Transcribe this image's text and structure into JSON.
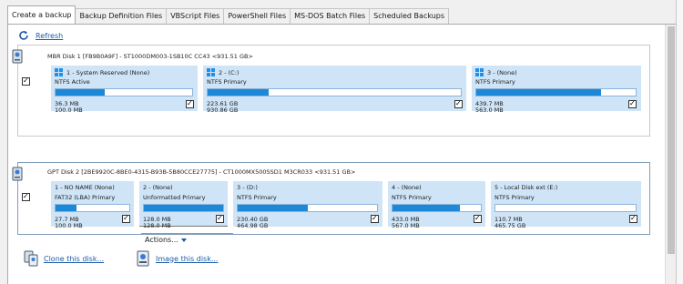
{
  "tabs": [
    {
      "label": "Create a backup",
      "active": true
    },
    {
      "label": "Backup Definition Files",
      "active": false
    },
    {
      "label": "VBScript Files",
      "active": false
    },
    {
      "label": "PowerShell Files",
      "active": false
    },
    {
      "label": "MS-DOS Batch Files",
      "active": false
    },
    {
      "label": "Scheduled Backups",
      "active": false
    }
  ],
  "toolbar": {
    "refresh_label": "Refresh"
  },
  "disk1": {
    "title": "MBR Disk 1 [FB9B0A9F] - ST1000DM003-1SB10C CC43  <931.51 GB>",
    "checked": true,
    "partitions": [
      {
        "name": "1 - System Reserved (None)",
        "fs": "NTFS Active",
        "used": "36.3 MB",
        "total": "100.0 MB",
        "fill": 0.36,
        "win": true,
        "checked": true
      },
      {
        "name": "2 - (C:)",
        "fs": "NTFS Primary",
        "used": "223.61 GB",
        "total": "930.86 GB",
        "fill": 0.24,
        "win": true,
        "checked": true
      },
      {
        "name": "3 - (None)",
        "fs": "NTFS Primary",
        "used": "439.7 MB",
        "total": "563.0 MB",
        "fill": 0.78,
        "win": true,
        "checked": true
      }
    ]
  },
  "disk2": {
    "title": "GPT Disk 2 [2BE9920C-8BE0-4315-B93B-5B80CCE27775] - CT1000MX500SSD1 M3CR033  <931.51 GB>",
    "checked": true,
    "partitions": [
      {
        "name": "1 - NO NAME (None)",
        "fs": "FAT32 (LBA) Primary",
        "used": "27.7 MB",
        "total": "100.0 MB",
        "fill": 0.28,
        "checked": true
      },
      {
        "name": "2 - (None)",
        "fs": "Unformatted Primary",
        "used": "128.0 MB",
        "total": "128.0 MB",
        "fill": 1.0,
        "checked": true
      },
      {
        "name": "3 - (D:)",
        "fs": "NTFS Primary",
        "used": "230.40 GB",
        "total": "464.98 GB",
        "fill": 0.5,
        "checked": true
      },
      {
        "name": "4 - (None)",
        "fs": "NTFS Primary",
        "used": "433.0 MB",
        "total": "567.0 MB",
        "fill": 0.76,
        "checked": true
      },
      {
        "name": "5 - Local Disk ext (E:)",
        "fs": "NTFS Primary",
        "used": "110.7 MB",
        "total": "465.75 GB",
        "fill": 0.0,
        "checked": true
      }
    ],
    "actions_label": "Actions..."
  },
  "links": {
    "clone_label": "Clone this disk...",
    "image_label": "Image this disk..."
  },
  "colors": {
    "accent": "#1e88d8",
    "partition_bg": "#cfe5f7",
    "link": "#1a5aa8"
  }
}
